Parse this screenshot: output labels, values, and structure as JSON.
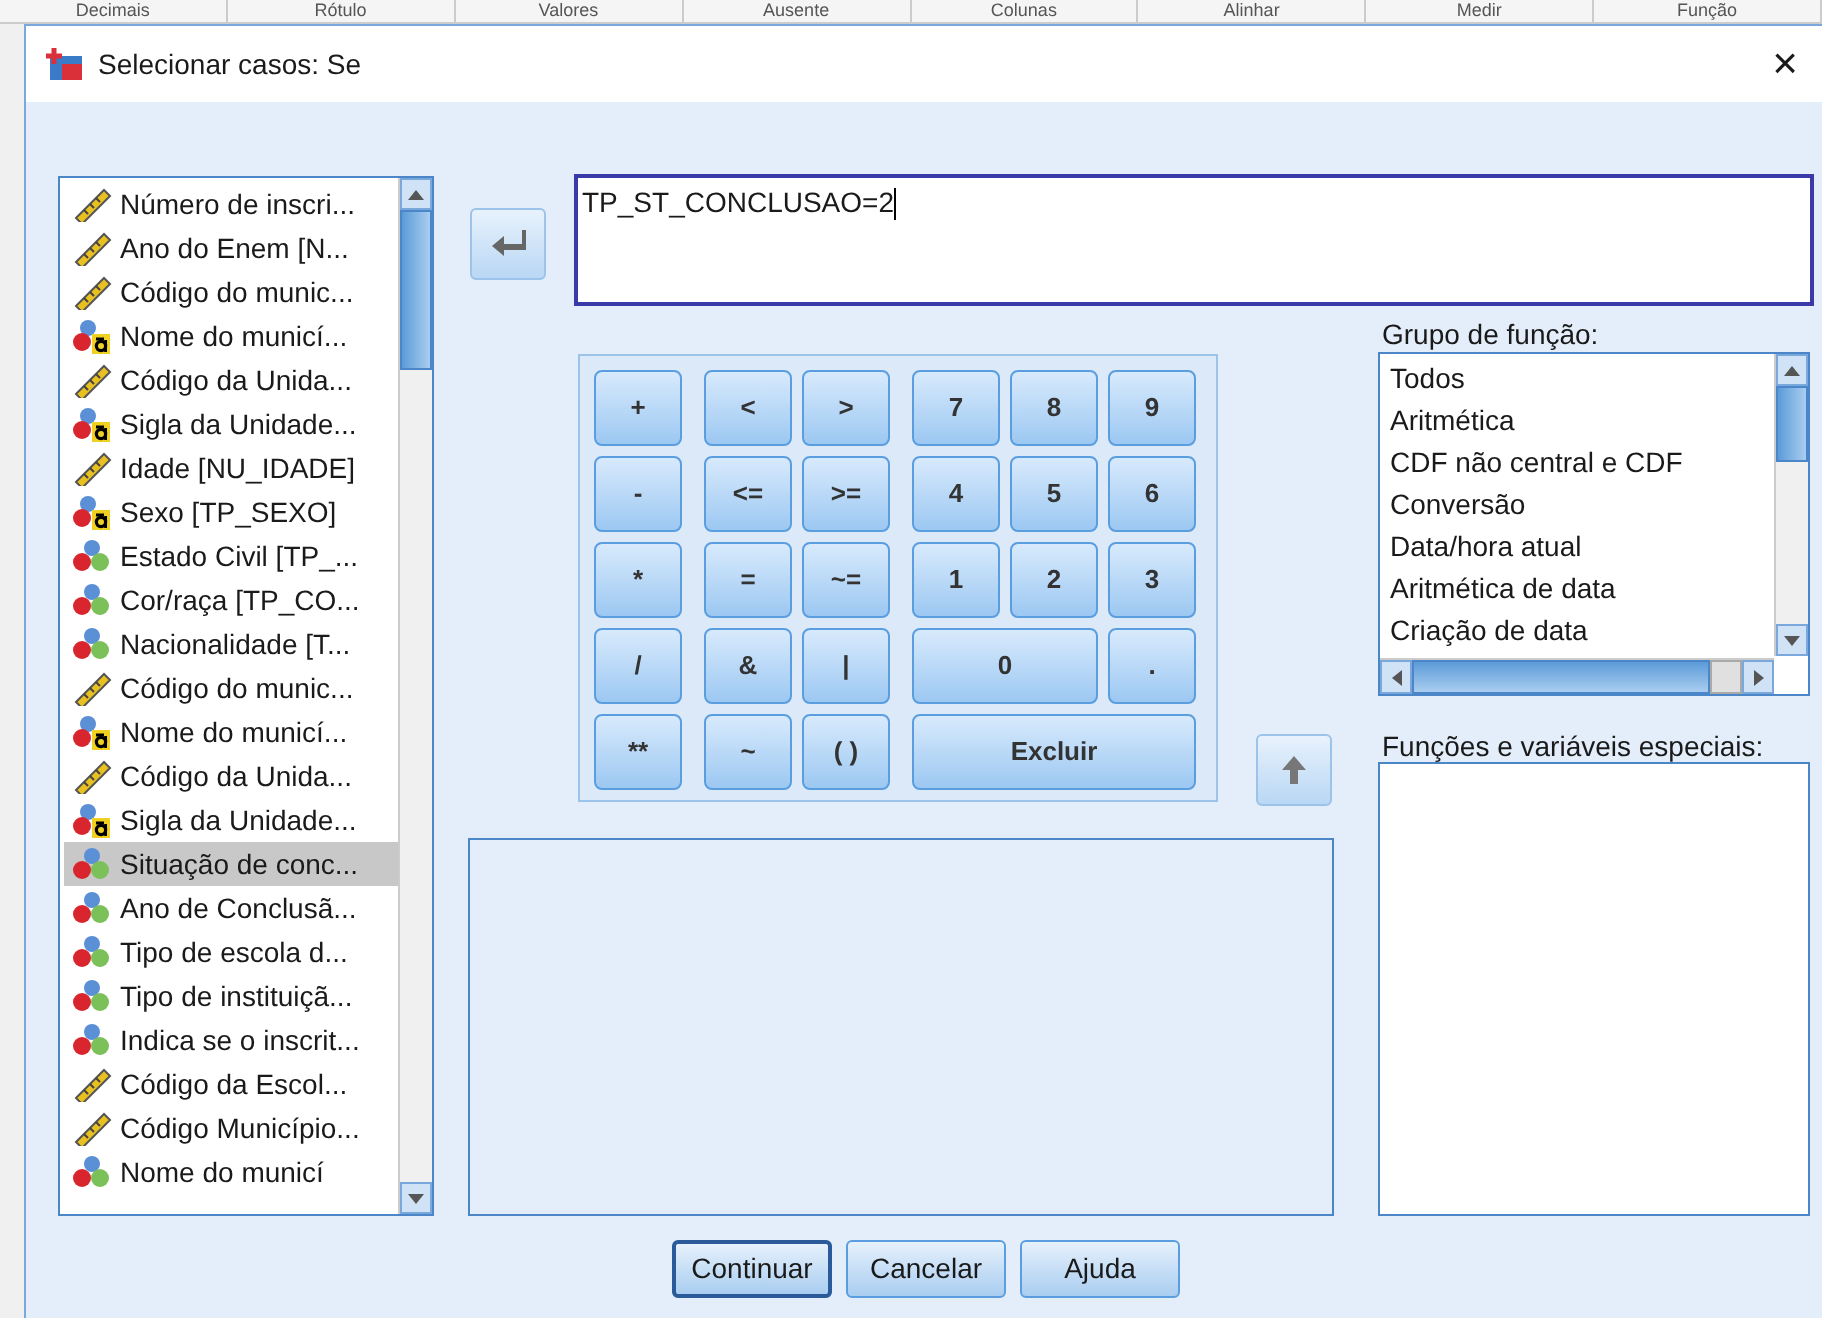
{
  "background_headers": [
    "Decimais",
    "Rótulo",
    "Valores",
    "Ausente",
    "Colunas",
    "Alinhar",
    "Medir",
    "Função"
  ],
  "window": {
    "title": "Selecionar casos: Se",
    "close": "×"
  },
  "variables": [
    {
      "label": "Número de inscri...",
      "kind": "scale",
      "selected": false
    },
    {
      "label": "Ano do Enem [N...",
      "kind": "scale",
      "selected": false
    },
    {
      "label": "Código do munic...",
      "kind": "scale",
      "selected": false
    },
    {
      "label": "Nome do municí...",
      "kind": "string",
      "selected": false
    },
    {
      "label": "Código da Unida...",
      "kind": "scale",
      "selected": false
    },
    {
      "label": "Sigla da Unidade...",
      "kind": "string",
      "selected": false
    },
    {
      "label": "Idade [NU_IDADE]",
      "kind": "scale",
      "selected": false
    },
    {
      "label": "Sexo [TP_SEXO]",
      "kind": "string",
      "selected": false
    },
    {
      "label": "Estado Civil [TP_...",
      "kind": "nominal",
      "selected": false
    },
    {
      "label": "Cor/raça [TP_CO...",
      "kind": "nominal",
      "selected": false
    },
    {
      "label": "Nacionalidade [T...",
      "kind": "nominal",
      "selected": false
    },
    {
      "label": "Código do munic...",
      "kind": "scale",
      "selected": false
    },
    {
      "label": "Nome do municí...",
      "kind": "string",
      "selected": false
    },
    {
      "label": "Código da Unida...",
      "kind": "scale",
      "selected": false
    },
    {
      "label": "Sigla da Unidade...",
      "kind": "string",
      "selected": false
    },
    {
      "label": "Situação de conc...",
      "kind": "nominal",
      "selected": true
    },
    {
      "label": "Ano de Conclusã...",
      "kind": "nominal",
      "selected": false
    },
    {
      "label": "Tipo de escola d...",
      "kind": "nominal",
      "selected": false
    },
    {
      "label": "Tipo de instituiçã...",
      "kind": "nominal",
      "selected": false
    },
    {
      "label": "Indica se o inscrit...",
      "kind": "nominal",
      "selected": false
    },
    {
      "label": "Código da Escol...",
      "kind": "scale",
      "selected": false
    },
    {
      "label": "Código Município...",
      "kind": "scale",
      "selected": false
    },
    {
      "label": "Nome do municí",
      "kind": "nominal",
      "selected": false
    }
  ],
  "expression": {
    "value": "TP_ST_CONCLUSAO=2"
  },
  "keypad": [
    [
      {
        "label": "+",
        "kind": "key"
      },
      {
        "label": "<",
        "kind": "key"
      },
      {
        "label": ">",
        "kind": "key"
      },
      {
        "label": "7",
        "kind": "key"
      },
      {
        "label": "8",
        "kind": "key"
      },
      {
        "label": "9",
        "kind": "key"
      }
    ],
    [
      {
        "label": "-",
        "kind": "key"
      },
      {
        "label": "<=",
        "kind": "key"
      },
      {
        "label": ">=",
        "kind": "key"
      },
      {
        "label": "4",
        "kind": "key"
      },
      {
        "label": "5",
        "kind": "key"
      },
      {
        "label": "6",
        "kind": "key"
      }
    ],
    [
      {
        "label": "*",
        "kind": "key"
      },
      {
        "label": "=",
        "kind": "key"
      },
      {
        "label": "~=",
        "kind": "key"
      },
      {
        "label": "1",
        "kind": "key"
      },
      {
        "label": "2",
        "kind": "key"
      },
      {
        "label": "3",
        "kind": "key"
      }
    ],
    [
      {
        "label": "/",
        "kind": "key"
      },
      {
        "label": "&",
        "kind": "key"
      },
      {
        "label": "|",
        "kind": "key"
      },
      {
        "label": "0",
        "kind": "double"
      },
      {
        "label": ".",
        "kind": "key"
      }
    ],
    [
      {
        "label": "**",
        "kind": "key"
      },
      {
        "label": "~",
        "kind": "key"
      },
      {
        "label": "( )",
        "kind": "key"
      },
      {
        "label": "Excluir",
        "kind": "triple"
      }
    ]
  ],
  "function_group": {
    "label": "Grupo de função:",
    "items": [
      "Todos",
      "Aritmética",
      "CDF não central e CDF",
      "Conversão",
      "Data/hora atual",
      "Aritmética de data",
      "Criação de data"
    ]
  },
  "special_functions": {
    "label": "Funções e variáveis especiais:"
  },
  "buttons": [
    {
      "label": "Continuar",
      "default": true
    },
    {
      "label": "Cancelar",
      "default": false
    },
    {
      "label": "Ajuda",
      "default": false
    }
  ]
}
